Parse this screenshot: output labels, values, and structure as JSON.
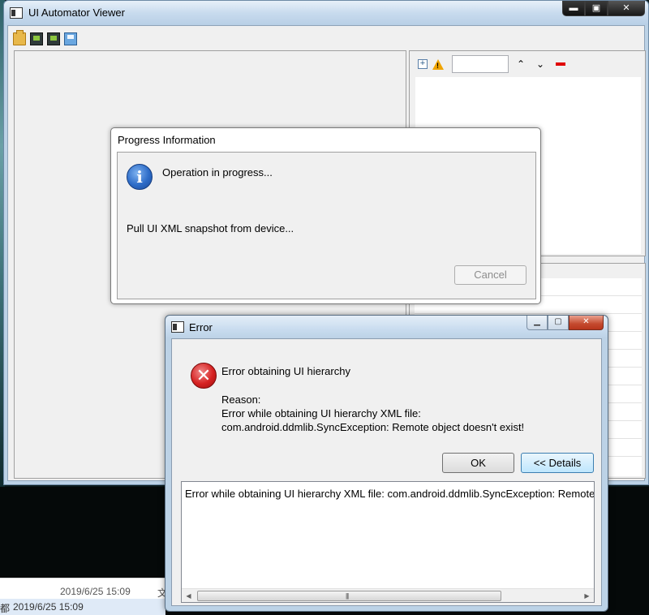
{
  "main_window": {
    "title": "UI Automator Viewer",
    "caption_buttons": {
      "minimize": "▬",
      "maximize": "▣",
      "close": "✕"
    },
    "toolbar_icons": [
      "open-folder-icon",
      "device-screenshot-icon",
      "device-screenshot-compressed-icon",
      "save-icon"
    ],
    "right_toolbar": {
      "icons": [
        "expand-all-icon",
        "warning-icon",
        "minus-icon"
      ],
      "up_arrow": "⌃",
      "down_arrow": "⌄"
    }
  },
  "progress_dialog": {
    "title": "Progress Information",
    "operation": "Operation in progress...",
    "subtask": "Pull UI XML snapshot from device...",
    "cancel_label": "Cancel"
  },
  "error_dialog": {
    "title": "Error",
    "heading": "Error obtaining UI hierarchy",
    "reason_label": "Reason:",
    "reason_line1": "Error while obtaining UI hierarchy XML file:",
    "reason_line2": "com.android.ddmlib.SyncException: Remote object doesn't exist!",
    "ok_label": "OK",
    "details_label": "<< Details",
    "details_text": "Error while obtaining UI hierarchy XML file: com.android.ddmlib.SyncException: Remote object doesn't exist!",
    "scroll_grip": "|||",
    "scroll_left": "◀",
    "scroll_right": "▶"
  },
  "background": {
    "date1": "2019/6/25 15:09",
    "date2": "2019/6/25 15:09",
    "partial_char1": "文",
    "partial_char2": "都"
  }
}
